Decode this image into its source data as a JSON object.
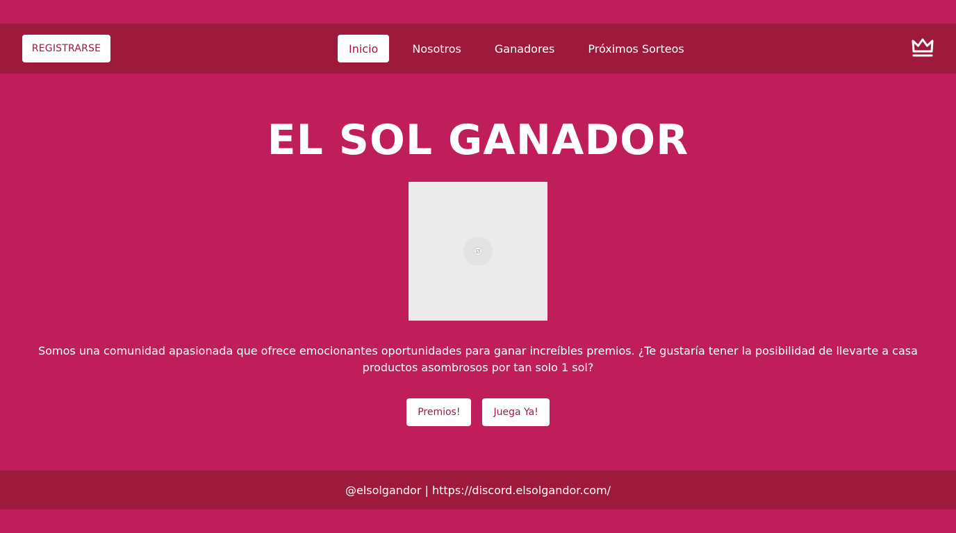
{
  "colors": {
    "page_bg": "#bf1e5a",
    "bar_bg": "#9e1a3c",
    "button_bg": "#ffffff",
    "button_text": "#9e1a3c",
    "image_placeholder": "#ebebeb"
  },
  "header": {
    "register_label": "REGISTRARSE",
    "nav": [
      {
        "label": "Inicio",
        "active": true
      },
      {
        "label": "Nosotros",
        "active": false
      },
      {
        "label": "Ganadores",
        "active": false
      },
      {
        "label": "Próximos Sorteos",
        "active": false
      }
    ],
    "logo_icon": "crown-icon"
  },
  "hero": {
    "title": "EL SOL GANADOR",
    "image_icon": "broken-image-icon",
    "description": "Somos una comunidad apasionada que ofrece emocionantes oportunidades para ganar increíbles premios. ¿Te gustaría tener la posibilidad de llevarte a casa productos asombrosos por tan solo 1 sol?",
    "buttons": [
      {
        "label": "Premios!"
      },
      {
        "label": "Juega Ya!"
      }
    ]
  },
  "footer": {
    "text": "@elsolgandor | https://discord.elsolgandor.com/"
  }
}
